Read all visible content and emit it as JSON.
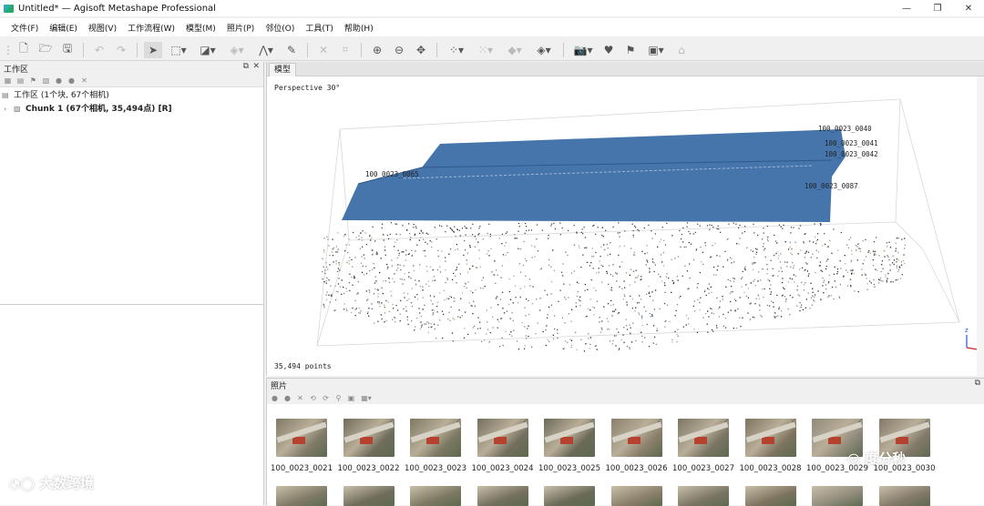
{
  "window": {
    "title": "Untitled* — Agisoft Metashape Professional",
    "controls": {
      "minimize": "—",
      "restore": "❐",
      "close": "✕"
    }
  },
  "menu": [
    "文件(F)",
    "编辑(E)",
    "视图(V)",
    "工作流程(W)",
    "模型(M)",
    "照片(P)",
    "邻位(O)",
    "工具(T)",
    "帮助(H)"
  ],
  "workspace": {
    "title": "工作区",
    "root_label": "工作区 (1个块, 67个相机)",
    "chunk_label": "Chunk 1 (67个相机, 35,494点) [R]",
    "float_icon": "⧉",
    "close_icon": "✕"
  },
  "viewer": {
    "tab_label": "模型",
    "perspective_label": "Perspective 30°",
    "points_label": "35,494 points",
    "camera_labels": [
      "100_0023_0065",
      "100_0023_0040",
      "100_0023_0041",
      "100_0023_0042",
      "100_0023_0087"
    ]
  },
  "photos_panel": {
    "title": "照片",
    "float_icon": "⧉",
    "thumbnails": [
      {
        "label": "100_0023_0021",
        "color": "#7f7a66"
      },
      {
        "label": "100_0023_0022",
        "color": "#6f6c5c"
      },
      {
        "label": "100_0023_0023",
        "color": "#7c7862"
      },
      {
        "label": "100_0023_0024",
        "color": "#736e5e"
      },
      {
        "label": "100_0023_0025",
        "color": "#6a6a58"
      },
      {
        "label": "100_0023_0026",
        "color": "#8a7f6a"
      },
      {
        "label": "100_0023_0027",
        "color": "#7a7564"
      },
      {
        "label": "100_0023_0028",
        "color": "#7d735f"
      },
      {
        "label": "100_0023_0029",
        "color": "#8f8a7a"
      },
      {
        "label": "100_0023_0030",
        "color": "#83796a"
      }
    ]
  },
  "watermarks": {
    "left": "大数跨境",
    "right": "度分秒"
  }
}
